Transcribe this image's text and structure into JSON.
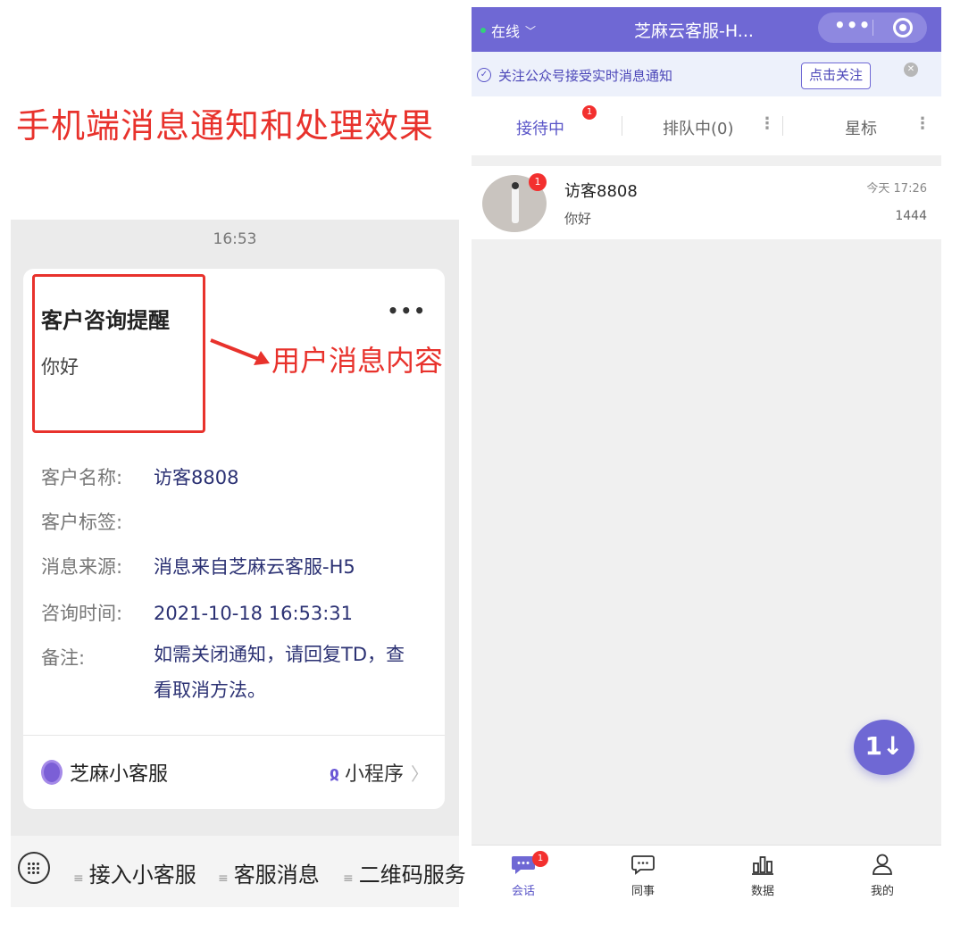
{
  "left": {
    "headline": "手机端消息通知和处理效果",
    "annotation": "用户消息内容",
    "status_time": "16:53",
    "card": {
      "title": "客户咨询提醒",
      "more": "•••",
      "body": "你好",
      "fields": [
        {
          "label": "客户名称:",
          "value": "访客8808"
        },
        {
          "label": "客户标签:",
          "value": ""
        },
        {
          "label": "消息来源:",
          "value": "消息来自芝麻云客服-H5"
        },
        {
          "label": "咨询时间:",
          "value": "2021-10-18 16:53:31"
        },
        {
          "label": "备注:",
          "value": "如需关闭通知，请回复TD，查看取消方法。"
        }
      ],
      "app_name": "芝麻小客服",
      "mini_program": "小程序"
    },
    "menu": [
      "接入小客服",
      "客服消息",
      "二维码服务"
    ]
  },
  "right": {
    "status": "在线",
    "title": "芝麻云客服-H...",
    "capsule_more": "•••",
    "follow_text": "关注公众号接受实时消息通知",
    "follow_button": "点击关注",
    "tabs": [
      {
        "label": "接待中",
        "badge": "1"
      },
      {
        "label": "排队中(0)"
      },
      {
        "label": "星标"
      }
    ],
    "conversation": {
      "name": "访客8808",
      "message": "你好",
      "time": "今天 17:26",
      "count": "1444",
      "badge": "1"
    },
    "fab_label": "1↓",
    "nav": [
      {
        "label": "会话",
        "badge": "1",
        "icon": "chat-bubble-icon"
      },
      {
        "label": "同事",
        "icon": "message-icon"
      },
      {
        "label": "数据",
        "icon": "bar-chart-icon"
      },
      {
        "label": "我的",
        "icon": "user-icon"
      }
    ]
  },
  "colors": {
    "accent": "#6f68d4",
    "alert_red": "#e8322c",
    "badge_red": "#f3302f"
  }
}
